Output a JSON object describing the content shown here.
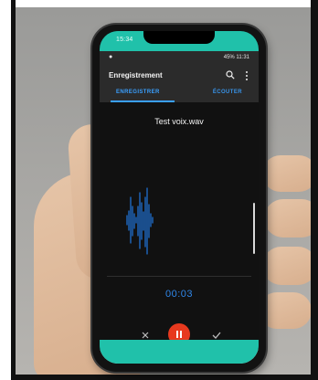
{
  "phone": {
    "outer_status": {
      "time": "15:34",
      "icons": ""
    },
    "status_bar": {
      "left": "●",
      "right": "45% 11:31"
    },
    "app_bar": {
      "title": "Enregistrement",
      "search_icon": "search-icon",
      "more_icon": "more-vertical-icon"
    },
    "tabs": [
      {
        "label": "ENREGISTRER",
        "active": true
      },
      {
        "label": "ÉCOUTER",
        "active": false
      }
    ],
    "recording": {
      "file_name": "Test voix.wav",
      "elapsed": "00:03"
    },
    "controls": {
      "cancel_icon": "close-icon",
      "pause_icon": "pause-icon",
      "confirm_icon": "check-icon"
    },
    "nav_bar": {
      "items": [
        "•",
        "◁",
        "□",
        "◁"
      ]
    }
  },
  "colors": {
    "accent_teal": "#20c1aa",
    "tab_accent": "#3aa0ff",
    "record_red": "#e7391e",
    "timer_blue": "#2f86e8"
  }
}
